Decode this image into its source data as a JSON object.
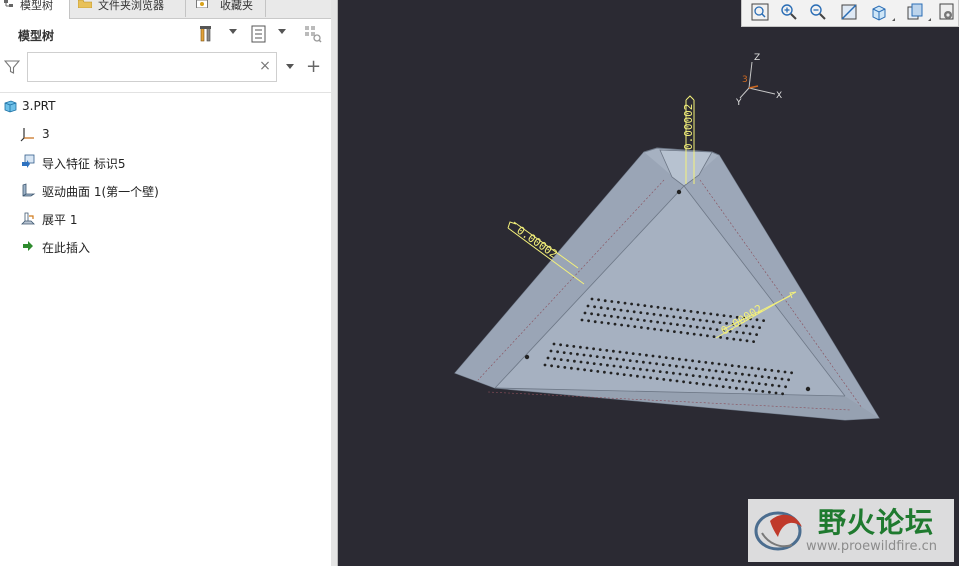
{
  "tabs": [
    {
      "label": "模型树",
      "active": true
    },
    {
      "label": "文件夹浏览器",
      "active": false
    },
    {
      "label": "收藏夹",
      "active": false
    }
  ],
  "panel": {
    "title": "模型树"
  },
  "search": {
    "value": "",
    "placeholder": ""
  },
  "tree": {
    "items": [
      {
        "label": "3.PRT",
        "icon": "part-icon"
      },
      {
        "label": "3",
        "icon": "coordinate-system-icon"
      },
      {
        "label": "导入特征 标识5",
        "icon": "import-feature-icon"
      },
      {
        "label": "驱动曲面 1(第一个壁)",
        "icon": "driving-surface-icon"
      },
      {
        "label": "展平 1",
        "icon": "flatten-icon"
      },
      {
        "label": "在此插入",
        "icon": "insert-here-arrow-icon"
      }
    ]
  },
  "triad": {
    "z": "Z",
    "y": "Y",
    "x": "X",
    "origin": "3"
  },
  "dimension_labels": {
    "top": "0.00002",
    "left": "0.00002",
    "right": "0.00002"
  },
  "view_toolbar": [
    "refit-icon",
    "zoom-in-icon",
    "zoom-out-icon",
    "repaint-icon",
    "saved-orientations-icon",
    "display-style-icon",
    "view-manager-icon"
  ],
  "watermark": {
    "title": "野火论坛",
    "url": "www.proewildfire.cn"
  },
  "colors": {
    "viewport_bg": "#2b2a33",
    "sheet_metal": "#a6b1c1",
    "dimension": "#f4f17a",
    "tree_green_arrow": "#2e8b2e"
  }
}
